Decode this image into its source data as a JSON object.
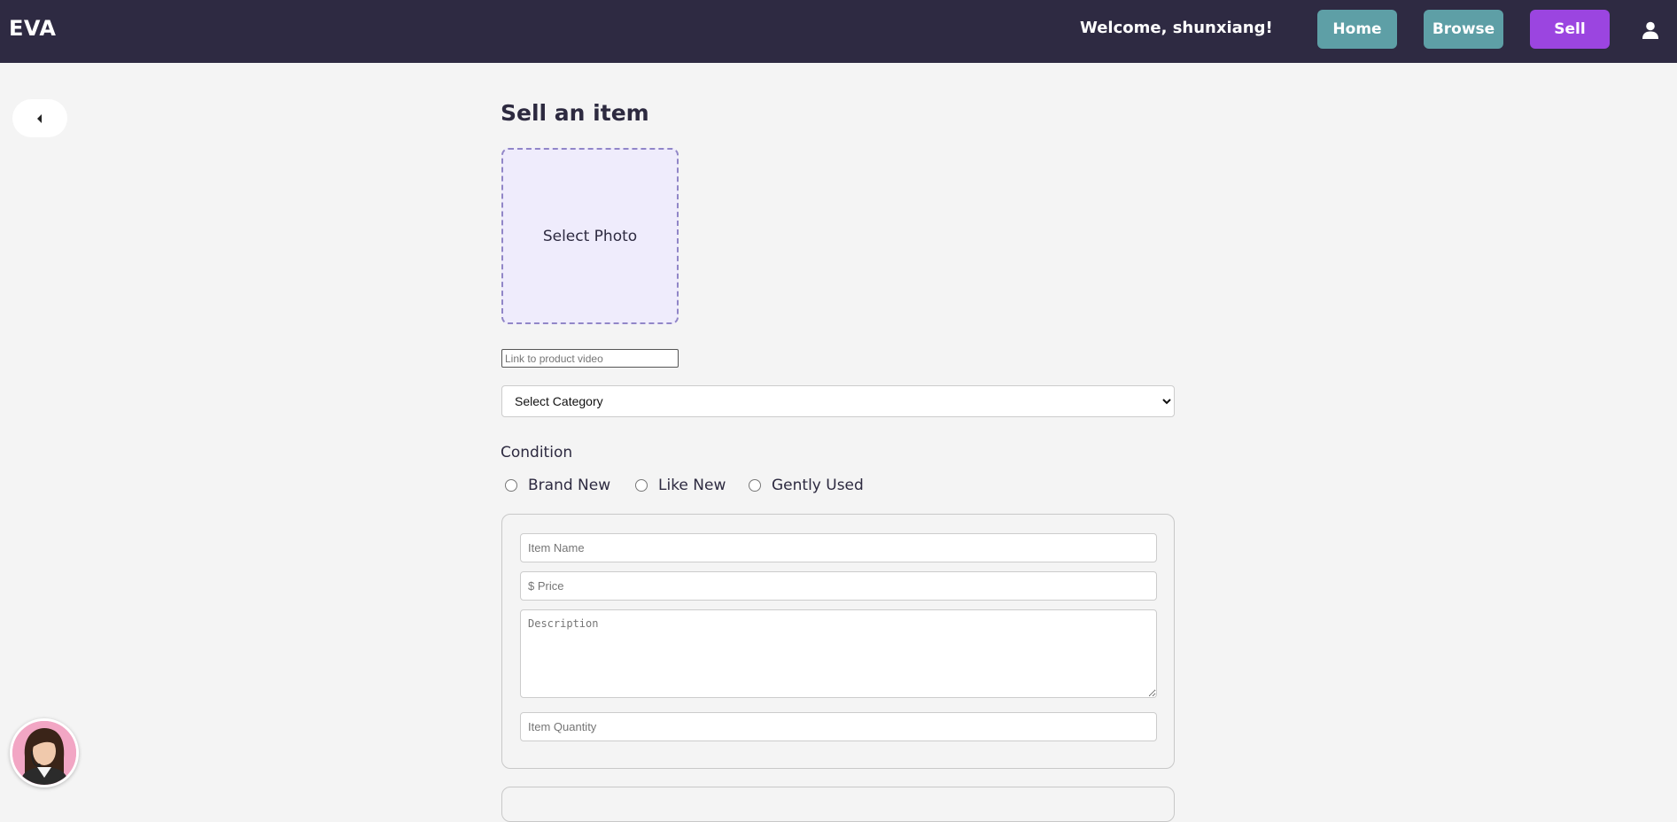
{
  "navbar": {
    "brand": "EVA",
    "welcome": "Welcome, shunxiang!",
    "home_label": "Home",
    "browse_label": "Browse",
    "sell_label": "Sell",
    "user_icon": "user-icon"
  },
  "back_button": {
    "icon": "caret-left-icon"
  },
  "form": {
    "title": "Sell an item",
    "photo_label": "Select Photo",
    "video_placeholder": "Link to product video",
    "category_selected": "Select Category",
    "condition_label": "Condition",
    "conditions": [
      {
        "label": "Brand New"
      },
      {
        "label": "Like New"
      },
      {
        "label": "Gently Used"
      }
    ],
    "item_name_placeholder": "Item Name",
    "price_placeholder": "$ Price",
    "description_placeholder": "Description",
    "quantity_placeholder": "Item Quantity"
  },
  "colors": {
    "navbar": "#2e2a42",
    "home_btn": "#5e9fa6",
    "browse_btn": "#5e9fa6",
    "sell_btn": "#9b45e0",
    "photo_bg": "#efecfc",
    "page_bg": "#f4f4f4"
  },
  "assistant": {
    "icon": "assistant-avatar-icon"
  }
}
